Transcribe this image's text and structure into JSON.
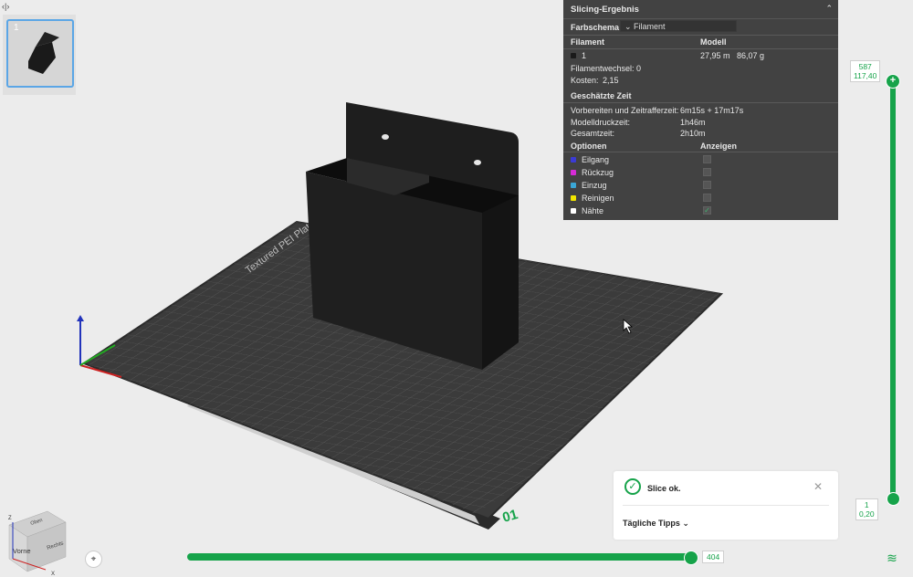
{
  "top": {
    "collapse_icon": "‹|›"
  },
  "plate_thumbnail": {
    "number": "1"
  },
  "slicing_panel": {
    "title": "Slicing-Ergebnis",
    "collapse_icon": "⌃",
    "color_scheme_label": "Farbschema",
    "color_scheme_value": "Filament",
    "filament_header": "Filament",
    "model_header": "Modell",
    "filament_id": "1",
    "filament_length": "27,95 m",
    "filament_weight": "86,07 g",
    "filament_changes_label": "Filamentwechsel:",
    "filament_changes_value": "0",
    "cost_label": "Kosten:",
    "cost_value": "2,15",
    "time_header": "Geschätzte Zeit",
    "prep_label": "Vorbereiten und Zeitrafferzeit:",
    "prep_value": "6m15s + 17m17s",
    "model_time_label": "Modelldruckzeit:",
    "model_time_value": "1h46m",
    "total_label": "Gesamtzeit:",
    "total_value": "2h10m",
    "options_header": "Optionen",
    "show_header": "Anzeigen",
    "options": [
      {
        "label": "Eilgang",
        "color": "#3b3bd6",
        "checked": false
      },
      {
        "label": "Rückzug",
        "color": "#d62bd6",
        "checked": false
      },
      {
        "label": "Einzug",
        "color": "#3aa7d6",
        "checked": false
      },
      {
        "label": "Reinigen",
        "color": "#f2e600",
        "checked": false
      },
      {
        "label": "Nähte",
        "color": "#ffffff",
        "checked": true
      }
    ]
  },
  "layer_slider": {
    "top_layer": "587",
    "top_height": "117,40",
    "bottom_layer": "1",
    "bottom_height": "0,20",
    "plus_icon": "+"
  },
  "move_slider": {
    "value": "404"
  },
  "notification": {
    "icon": "✓",
    "message": "Slice ok.",
    "close_icon": "✕",
    "tips_label": "Tägliche Tipps",
    "tips_chevron": "⌄"
  },
  "plate_labels": {
    "plate_number": "01",
    "plate_text": "Textured PEI Plate"
  },
  "view_cube": {
    "front": "Vorne",
    "right": "Rechts",
    "top": "Oben",
    "z_axis": "Z",
    "x_axis": "X"
  },
  "icons": {
    "camera": "⌖",
    "layers": "≋"
  },
  "colors": {
    "accent": "#16a34a",
    "panel_bg": "#424242",
    "bed": "#3b3b3b"
  }
}
